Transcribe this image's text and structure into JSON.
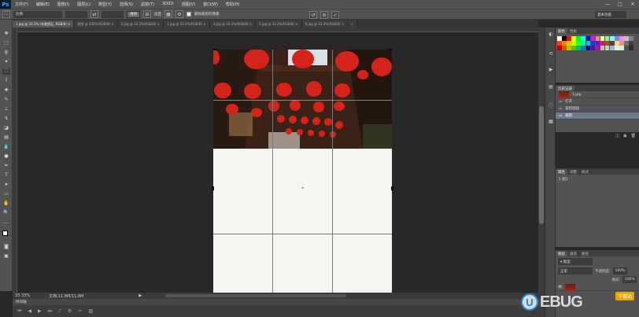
{
  "app": {
    "logo": "Ps"
  },
  "menu": [
    "文件(F)",
    "编辑(E)",
    "图像(I)",
    "图层(L)",
    "类型(Y)",
    "选择(S)",
    "滤镜(T)",
    "3D(D)",
    "视图(V)",
    "窗口(W)",
    "帮助(H)"
  ],
  "window_controls": [
    "—",
    "□",
    "✕"
  ],
  "options": {
    "style_label": "比例",
    "clear_button": "清除",
    "straighten_label": "拉直",
    "delete_pixels_label": "删除裁剪的像素",
    "workspace": "基本功能"
  },
  "tabs": [
    {
      "label": "1.jpg @ 33.3% (非裁剪区, RGB/8) ×",
      "active": true
    },
    {
      "label": "原图 @ 100%(RGB/8) ×",
      "active": false
    },
    {
      "label": "2.jpg @ 33.3%(RGB/8) ×",
      "active": false
    },
    {
      "label": "3.jpg @ 33.3%(RGB/8) ×",
      "active": false
    },
    {
      "label": "4.jpg @ 33.3%(RGB/8) ×",
      "active": false
    },
    {
      "label": "5.jpg @ 33.3%(RGB/8) ×",
      "active": false
    },
    {
      "label": "6.jpg @ 33.3%(RGB/8) ×",
      "active": false
    },
    {
      "label": "»",
      "active": false
    }
  ],
  "status": {
    "zoom": "33.33%",
    "doc": "文档:11.8M/11.8M"
  },
  "timeline": {
    "label": "时间轴"
  },
  "panels": {
    "color_tabs": [
      "颜色",
      "色板"
    ],
    "history_tabs": [
      "历史记录"
    ],
    "history_title": "1.jpg",
    "history_items": [
      "打开",
      "裁剪图层",
      "裁剪"
    ],
    "adj_tabs": [
      "属性",
      "调整",
      "样式"
    ],
    "adj_item": "1 图1",
    "layers_tabs": [
      "图层",
      "通道",
      "路径"
    ],
    "layers_kind": "正常",
    "opacity_label": "不透明度:",
    "opacity_value": "100%",
    "fill_label": "填充:",
    "fill_value": "100%"
  },
  "watermark": {
    "text": "UEBUG",
    "badge": "下载站"
  },
  "colors": {
    "accent": "#1e8ad6",
    "lantern": "#d4231a"
  },
  "swatch_colors": [
    "#ffffff",
    "#000000",
    "#ff0000",
    "#ffff00",
    "#00ff00",
    "#00ffff",
    "#0000ff",
    "#ff00ff",
    "#ff8080",
    "#ffff80",
    "#80ff80",
    "#80ffff",
    "#8080ff",
    "#ff80ff",
    "#c0c0c0",
    "#808080",
    "#ff4000",
    "#ff8000",
    "#ffc000",
    "#c0ff00",
    "#40ff00",
    "#00ff80",
    "#00c0ff",
    "#0040ff",
    "#8000ff",
    "#ff0080",
    "#a05020",
    "#604020",
    "#ffd0a0",
    "#d0a070",
    "#707070",
    "#404040",
    "#c00000",
    "#c06000",
    "#c0c000",
    "#60c000",
    "#00c060",
    "#0080c0",
    "#0000c0",
    "#6000c0",
    "#c000c0",
    "#e0b0b0",
    "#b0e0b0",
    "#b0b0e0",
    "#f0f0d0",
    "#d0f0f0",
    "#505050",
    "#303030"
  ]
}
